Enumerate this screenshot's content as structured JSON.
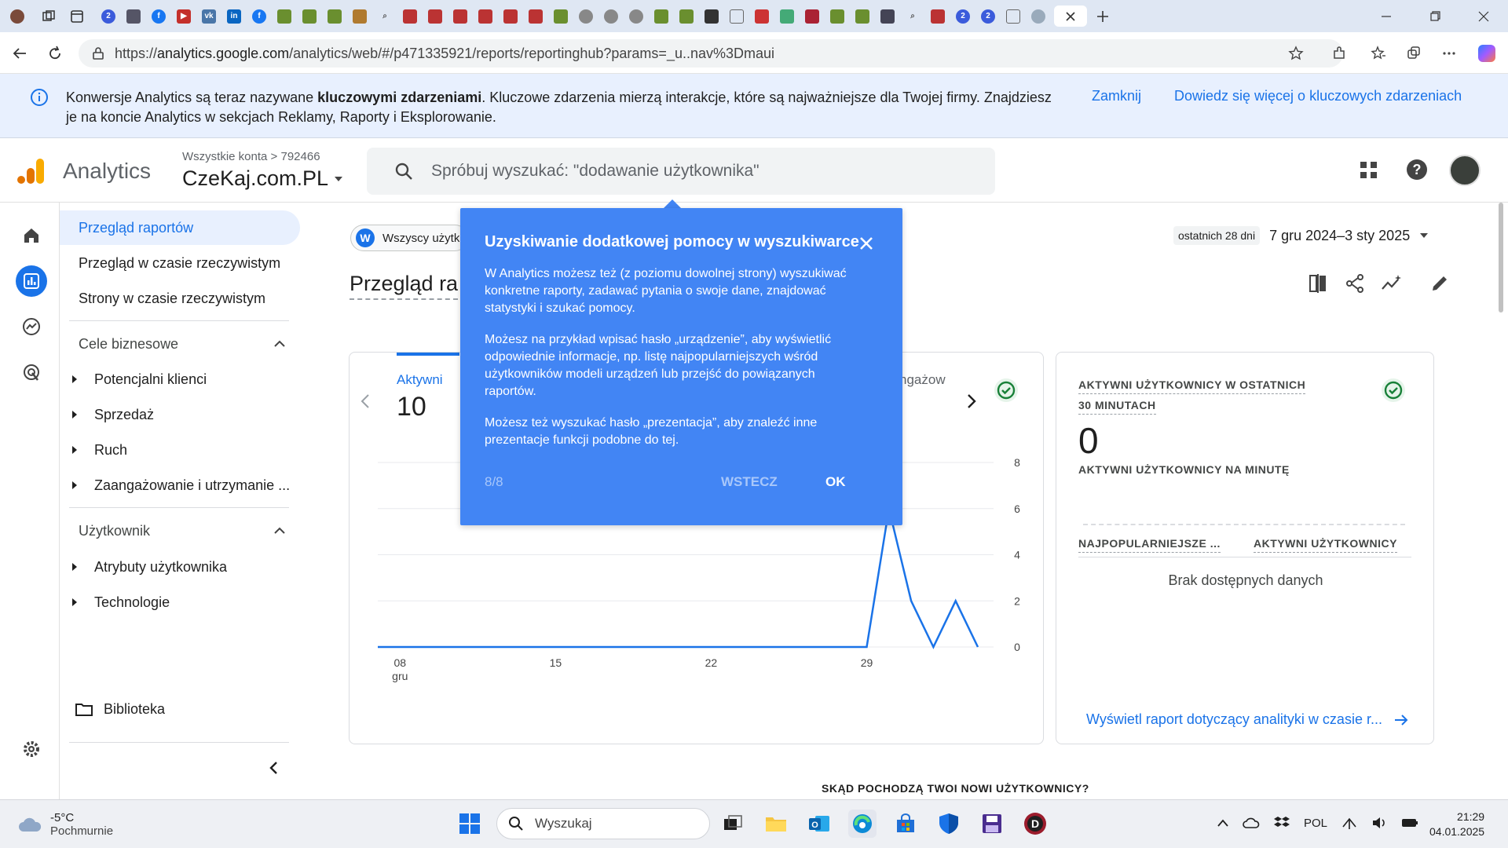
{
  "browser": {
    "url_prefix": "https://",
    "url_host": "analytics.google.com",
    "url_path": "/analytics/web/#/p471335921/reports/reportinghub?params=_u..nav%3Dmaui"
  },
  "banner": {
    "text_before": "Konwersje Analytics są teraz nazywane ",
    "text_bold": "kluczowymi zdarzeniami",
    "text_after": ". Kluczowe zdarzenia mierzą interakcje, które są najważniejsze dla Twojej firmy. Znajdziesz je na koncie Analytics w sekcjach Reklamy, Raporty i Eksplorowanie.",
    "close_label": "Zamknij",
    "more_label": "Dowiedz się więcej o kluczowych zdarzeniach"
  },
  "header": {
    "brand": "Analytics",
    "breadcrumb_all": "Wszystkie konta",
    "breadcrumb_sep": ">",
    "account_id": "792466",
    "property": "CzeKaj.com.PL",
    "search_placeholder": "Spróbuj wyszukać: \"dodawanie użytkownika\""
  },
  "sidebar": {
    "items": [
      {
        "label": "Przegląd raportów"
      },
      {
        "label": "Przegląd w czasie rzeczywistym"
      },
      {
        "label": "Strony w czasie rzeczywistym"
      }
    ],
    "section1": "Cele biznesowe",
    "section1_items": [
      "Potencjalni klienci",
      "Sprzedaż",
      "Ruch",
      "Zaangażowanie i utrzymanie ..."
    ],
    "section2": "Użytkownik",
    "section2_items": [
      "Atrybuty użytkownika",
      "Technologie"
    ],
    "library": "Biblioteka"
  },
  "main": {
    "chip_letter": "W",
    "chip_label": "Wszyscy użytk",
    "page_title": "Przegląd ra",
    "date_label": "ostatnich 28 dni",
    "date_value": "7 gru 2024–3 sty 2025",
    "metric_label": "Aktywni",
    "metric_value": "10",
    "metric2_label": "ngażow",
    "realtime_title_line1": "AKTYWNI UŻYTKOWNICY W OSTATNICH",
    "realtime_title_line2": "30 MINUTACH",
    "realtime_value": "0",
    "per_minute_label": "AKTYWNI UŻYTKOWNICY NA MINUTĘ",
    "col1": "NAJPOPULARNIEJSZE ...",
    "col2": "AKTYWNI UŻYTKOWNICY",
    "no_data": "Brak dostępnych danych",
    "realtime_link": "Wyświetl raport dotyczący analityki w czasie r...",
    "bottom_title": "SKĄD POCHODZĄ TWOI NOWI UŻYTKOWNICY?"
  },
  "chart_data": {
    "type": "line",
    "x_tick_labels": [
      "08",
      "15",
      "22",
      "29"
    ],
    "x_tick_sublabel": "gru",
    "y_tick_labels": [
      "8",
      "6",
      "4",
      "2",
      "0"
    ],
    "ylim": [
      0,
      8
    ],
    "x": [
      "2024-12-07",
      "2024-12-08",
      "2024-12-09",
      "2024-12-10",
      "2024-12-11",
      "2024-12-12",
      "2024-12-13",
      "2024-12-14",
      "2024-12-15",
      "2024-12-16",
      "2024-12-17",
      "2024-12-18",
      "2024-12-19",
      "2024-12-20",
      "2024-12-21",
      "2024-12-22",
      "2024-12-23",
      "2024-12-24",
      "2024-12-25",
      "2024-12-26",
      "2024-12-27",
      "2024-12-28",
      "2024-12-29",
      "2024-12-30",
      "2024-12-31",
      "2025-01-01",
      "2025-01-02",
      "2025-01-03"
    ],
    "series": [
      {
        "values": [
          0,
          0,
          0,
          0,
          0,
          0,
          0,
          0,
          0,
          0,
          0,
          0,
          0,
          0,
          0,
          0,
          0,
          0,
          0,
          0,
          0,
          0,
          0,
          6,
          2,
          0,
          2,
          0
        ]
      }
    ],
    "color": "#1a73e8"
  },
  "popup": {
    "title": "Uzyskiwanie dodatkowej pomocy w wyszukiwarce",
    "p1": "W Analytics możesz też (z poziomu dowolnej strony) wyszukiwać konkretne raporty, zadawać pytania o swoje dane, znajdować statystyki i szukać pomocy.",
    "p2": "Możesz na przykład wpisać hasło „urządzenie”, aby wyświetlić odpowiednie informacje, np. listę najpopularniejszych wśród użytkowników modeli urządzeń lub przejść do powiązanych raportów.",
    "p3": "Możesz też wyszukać hasło „prezentacja”, aby znaleźć inne prezentacje funkcji podobne do tej.",
    "step": "8/8",
    "back_label": "WSTECZ",
    "ok_label": "OK"
  },
  "taskbar": {
    "temperature": "-5°C",
    "weather": "Pochmurnie",
    "search_label": "Wyszukaj",
    "language": "POL",
    "time": "21:29",
    "date": "04.01.2025"
  },
  "colors": {
    "accent": "#1a73e8",
    "popup": "#4285f4",
    "banner": "#e8f0fe",
    "green_check": "#188038"
  }
}
